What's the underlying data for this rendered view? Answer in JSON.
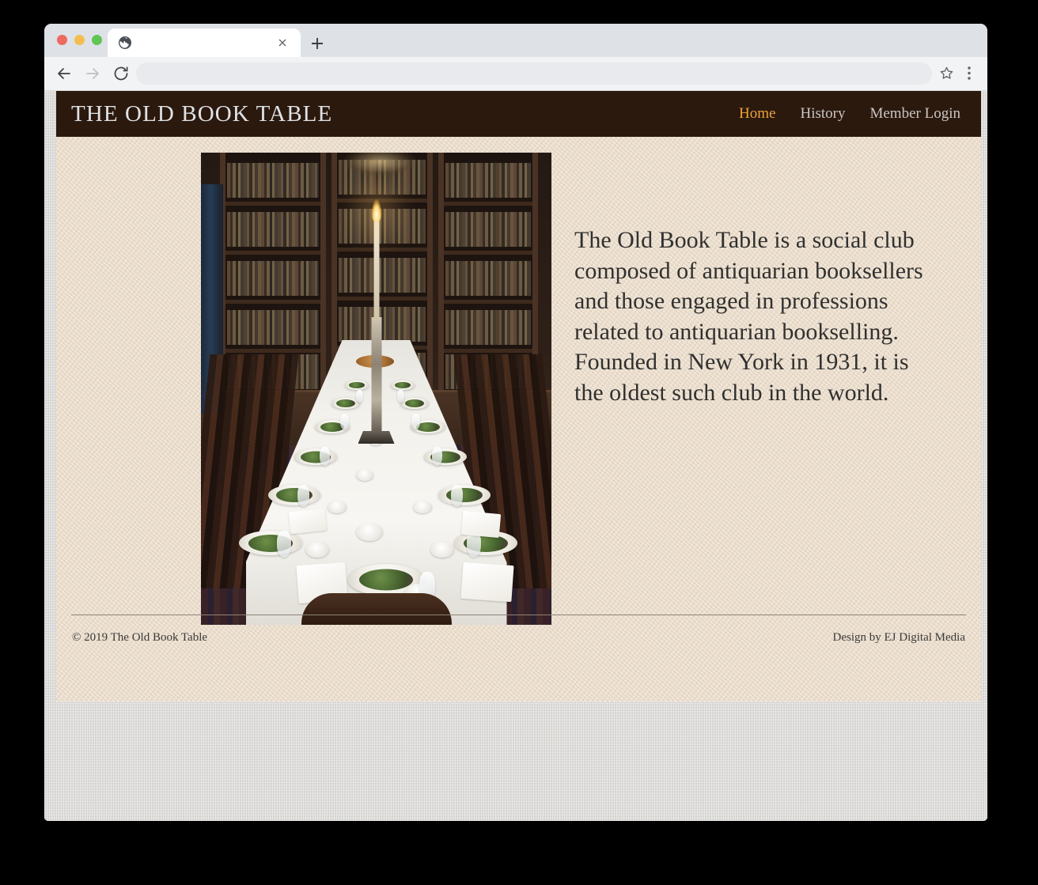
{
  "browser": {
    "traffic_lights": [
      "close",
      "minimize",
      "maximize"
    ],
    "tab": {
      "title": "",
      "favicon": "globe-icon",
      "close_label": "×"
    },
    "new_tab_label": "+",
    "toolbar": {
      "back_label": "←",
      "forward_label": "→",
      "reload_label": "⟳",
      "address_value": "",
      "address_placeholder": "",
      "star_label": "☆",
      "menu_label": "⋮"
    }
  },
  "site": {
    "title": "THE OLD BOOK TABLE",
    "nav": [
      {
        "label": "Home",
        "active": true
      },
      {
        "label": "History",
        "active": false
      },
      {
        "label": "Member Login",
        "active": false
      }
    ],
    "colors": {
      "header_bg": "#2c190e",
      "page_bg": "#e9dac7",
      "nav_active": "#eda53a",
      "nav_inactive": "#c9c7c4",
      "title_color": "#dfe2e6",
      "body_text": "#30302f",
      "footer_rule": "#8d8477"
    },
    "hero": {
      "image_alt": "Long banquet table set for dinner in a wood-panelled library with bookcases and a lit candelabra"
    },
    "intro": {
      "paragraph": "The Old Book Table is a social club composed of antiquarian booksellers and those engaged in professions related to antiquarian bookselling. Founded in New York in 1931, it is the oldest such club in the world."
    },
    "footer": {
      "copyright": "© 2019 The Old Book Table",
      "credit_prefix": "Design by ",
      "credit_link": "EJ Digital Media"
    }
  }
}
